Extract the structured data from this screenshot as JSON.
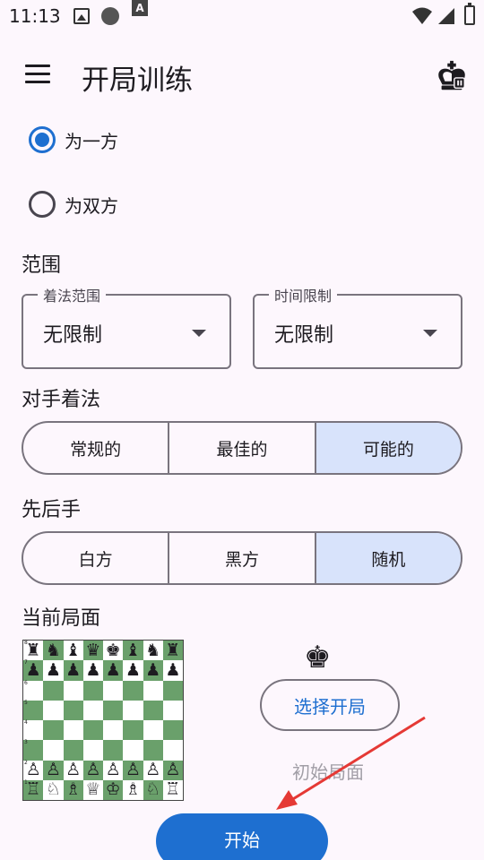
{
  "status_bar": {
    "time": "11:13"
  },
  "app_bar": {
    "title": "开局训练"
  },
  "play_side": {
    "options": [
      {
        "label": "为一方",
        "selected": true
      },
      {
        "label": "为双方",
        "selected": false
      }
    ]
  },
  "range": {
    "heading": "范围",
    "move_range": {
      "legend": "着法范围",
      "value": "无限制"
    },
    "time_limit": {
      "legend": "时间限制",
      "value": "无限制"
    }
  },
  "opponent_moves": {
    "heading": "对手着法",
    "options": [
      "常规的",
      "最佳的",
      "可能的"
    ],
    "selected": "可能的"
  },
  "move_order": {
    "heading": "先后手",
    "options": [
      "白方",
      "黑方",
      "随机"
    ],
    "selected": "随机"
  },
  "current_position": {
    "heading": "当前局面",
    "side_to_move_piece": "♚",
    "choose_opening_label": "选择开局",
    "position_label": "初始局面",
    "board": [
      [
        "♜",
        "♞",
        "♝",
        "♛",
        "♚",
        "♝",
        "♞",
        "♜"
      ],
      [
        "♟",
        "♟",
        "♟",
        "♟",
        "♟",
        "♟",
        "♟",
        "♟"
      ],
      [
        "",
        "",
        "",
        "",
        "",
        "",
        "",
        ""
      ],
      [
        "",
        "",
        "",
        "",
        "",
        "",
        "",
        ""
      ],
      [
        "",
        "",
        "",
        "",
        "",
        "",
        "",
        ""
      ],
      [
        "",
        "",
        "",
        "",
        "",
        "",
        "",
        ""
      ],
      [
        "♙",
        "♙",
        "♙",
        "♙",
        "♙",
        "♙",
        "♙",
        "♙"
      ],
      [
        "♖",
        "♘",
        "♗",
        "♕",
        "♔",
        "♗",
        "♘",
        "♖"
      ]
    ],
    "rank_labels": [
      "8",
      "7",
      "6",
      "5",
      "4",
      "3",
      "2",
      "1"
    ]
  },
  "start_button": {
    "label": "开始"
  },
  "colors": {
    "accent": "#1e6fd0",
    "segment_selected": "#d8e3fb",
    "board_dark": "#6aa06b",
    "annotation_arrow": "#e53935"
  }
}
